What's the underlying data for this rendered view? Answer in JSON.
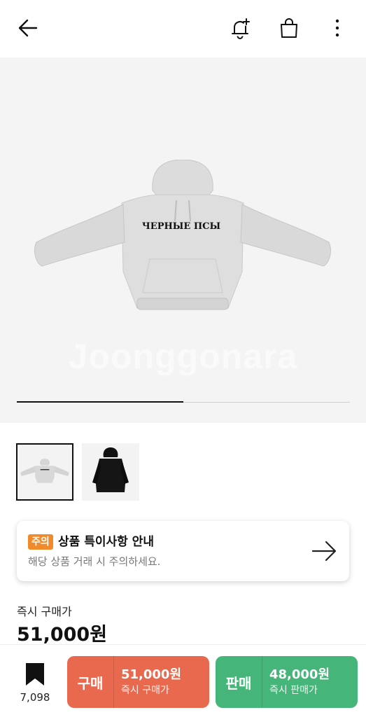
{
  "header": {
    "back_icon": "arrow-left-icon",
    "notify_icon": "bell-plus-icon",
    "cart_icon": "shopping-bag-icon",
    "more_icon": "more-vertical-icon"
  },
  "gallery": {
    "product_print_text": "ЧЕРНЫЕ ПСЫ",
    "watermark": "Joonggonara",
    "progress_fraction": 0.5,
    "thumbnails": [
      {
        "name": "grey-hoodie",
        "selected": true
      },
      {
        "name": "black-hoodie",
        "selected": false
      }
    ]
  },
  "notice": {
    "badge": "주의",
    "title": "상품 특이사항 안내",
    "subtitle": "해당 상품 거래 시 주의하세요.",
    "icon": "arrow-right-icon"
  },
  "price": {
    "label": "즉시 구매가",
    "value": "51,000원"
  },
  "bottom_bar": {
    "wish_icon": "bookmark-icon",
    "wish_count": "7,098",
    "buy": {
      "label": "구매",
      "price": "51,000원",
      "sub": "즉시 구매가",
      "color": "#e8694e"
    },
    "sell": {
      "label": "판매",
      "price": "48,000원",
      "sub": "즉시 판매가",
      "color": "#45b57a"
    }
  }
}
